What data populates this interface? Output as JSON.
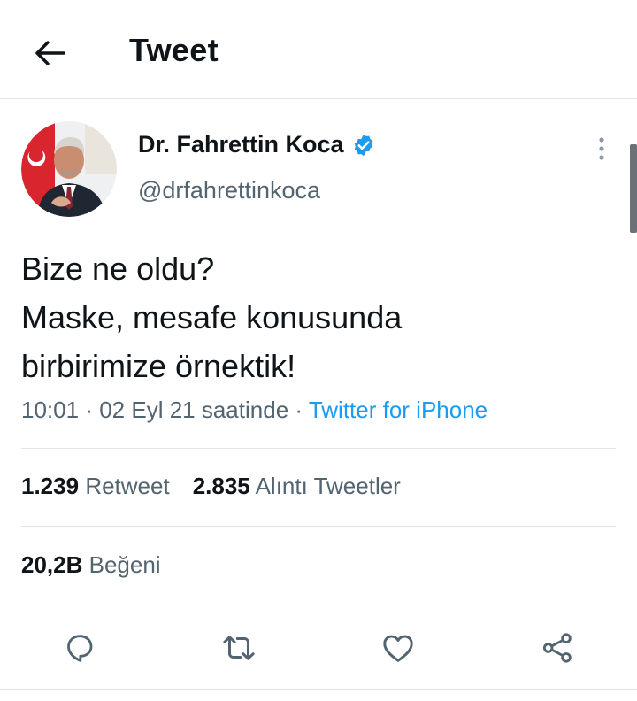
{
  "header": {
    "title": "Tweet",
    "back_icon": "arrow-left-icon"
  },
  "author": {
    "display_name": "Dr. Fahrettin Koca",
    "handle": "@drfahrettinkoca",
    "verified_icon": "verified-badge-icon"
  },
  "tweet": {
    "lines": [
      "Bize ne oldu?",
      "Maske, mesafe konusunda",
      "birbirimize örnektik!"
    ],
    "time": "10:01",
    "date": "02 Eyl 21 saatinde",
    "separator": "·",
    "source": "Twitter for iPhone"
  },
  "stats": {
    "retweets_count": "1.239",
    "retweets_label": "Retweet",
    "quotes_count": "2.835",
    "quotes_label": "Alıntı Tweetler",
    "likes_count": "20,2B",
    "likes_label": "Beğeni"
  },
  "actions": [
    {
      "name": "reply",
      "icon": "reply-icon"
    },
    {
      "name": "retweet",
      "icon": "retweet-icon"
    },
    {
      "name": "like",
      "icon": "heart-icon"
    },
    {
      "name": "share",
      "icon": "share-icon"
    }
  ],
  "colors": {
    "accent": "#1d9bf0",
    "text_primary": "#0f1419",
    "text_secondary": "#536471",
    "divider": "#e1e5e8"
  }
}
